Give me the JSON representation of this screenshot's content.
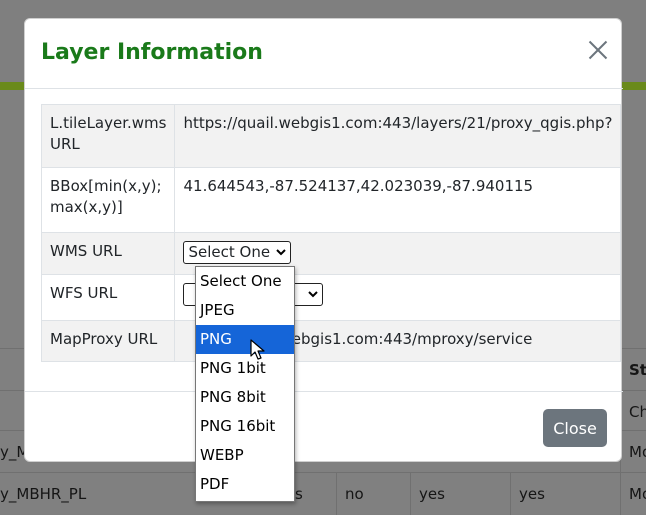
{
  "modal": {
    "title": "Layer Information",
    "close_label": "Close"
  },
  "rows": [
    {
      "key": "L.tileLayer.wms URL",
      "value": "https://quail.webgis1.com:443/layers/21/proxy_qgis.php?"
    },
    {
      "key": "BBox[min(x,y); max(x,y)]",
      "value": "41.644543,-87.524137,42.023039,-87.940115"
    },
    {
      "key": "WMS URL",
      "select_value": "Select One"
    },
    {
      "key": "WFS URL"
    },
    {
      "key": "MapProxy URL",
      "value": "webgis1.com:443/mproxy/service"
    }
  ],
  "dropdown": {
    "options": [
      "Select One",
      "JPEG",
      "PNG",
      "PNG 1bit",
      "PNG 8bit",
      "PNG 16bit",
      "WEBP",
      "PDF"
    ],
    "highlighted": "PNG"
  },
  "background_table": {
    "header_right": "Sto",
    "row1_right": "Ch",
    "row2_left": "y_M",
    "row2_right": "Mo",
    "row3_left": "y_MBHR_PL",
    "row3_cells": [
      "s",
      "no",
      "yes",
      "yes"
    ],
    "row3_right": "Mo"
  },
  "colors": {
    "title_green": "#1a7a1a",
    "accent_bar": "#6a8a1b",
    "selected_option": "#1565d8",
    "close_button": "#6c757d"
  }
}
